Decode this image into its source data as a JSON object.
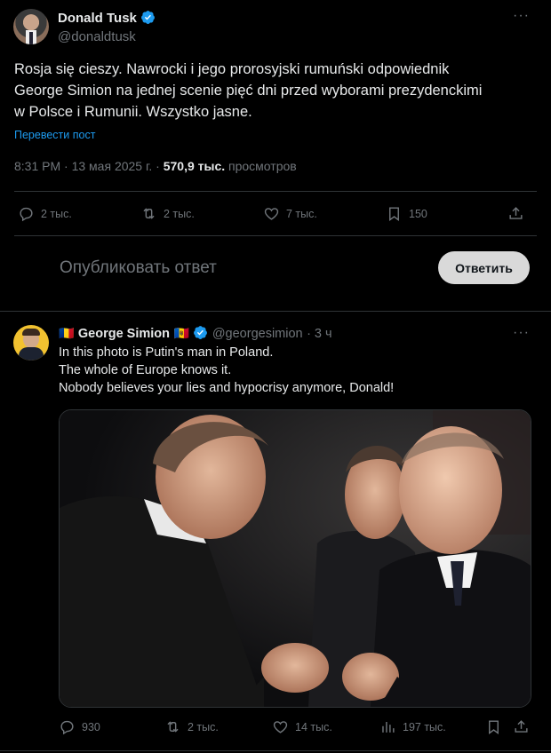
{
  "main_tweet": {
    "author_name": "Donald Tusk",
    "author_handle": "@donaldtusk",
    "text_lines": [
      "Rosja się cieszy. Nawrocki i jego prorosyjski rumuński odpowiednik",
      "George Simion na jednej scenie pięć dni przed wyborami prezydenckimi",
      "w Polsce i Rumunii. Wszystko jasne."
    ],
    "translate_label": "Перевести пост",
    "time": "8:31 PM",
    "date": "13 мая 2025 г.",
    "views_count": "570,9 тыс.",
    "views_label": "просмотров",
    "actions": {
      "replies": "2 тыс.",
      "reposts": "2 тыс.",
      "likes": "7 тыс.",
      "bookmarks": "150"
    }
  },
  "compose": {
    "placeholder": "Опубликовать ответ",
    "button_label": "Ответить"
  },
  "reply_tweet": {
    "author_name": "George Simion",
    "flag_left": "🇷🇴",
    "flag_right": "🇲🇩",
    "author_handle": "@georgesimion",
    "time_ago": "3 ч",
    "text_lines": [
      "In this photo is Putin's man in Poland.",
      "The whole of Europe knows it.",
      "Nobody believes your lies and hypocrisy anymore, Donald!"
    ],
    "actions": {
      "replies": "930",
      "reposts": "2 тыс.",
      "likes": "14 тыс.",
      "views": "197 тыс."
    }
  },
  "colors": {
    "background": "#000000",
    "text": "#e7e9ea",
    "muted": "#71767b",
    "link": "#1d9bf0",
    "divider": "#2f3336",
    "verified": "#1d9bf0"
  }
}
